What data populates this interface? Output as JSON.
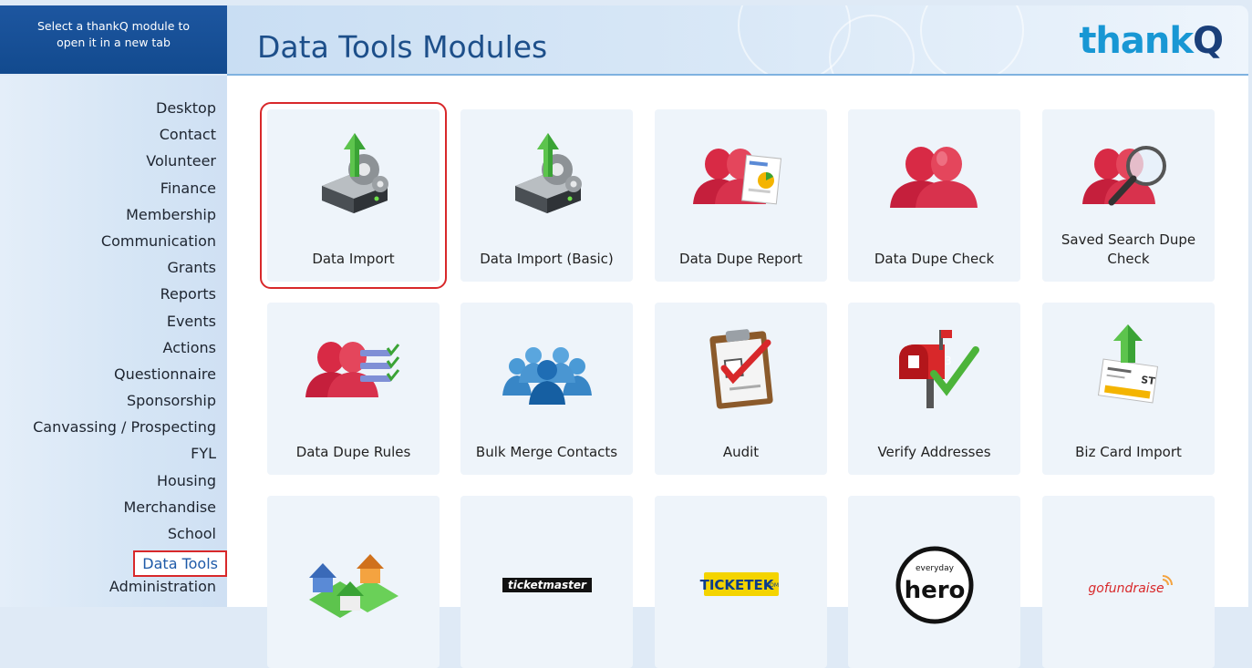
{
  "header": {
    "hint": "Select a thankQ module to open it in a new tab",
    "title": "Data Tools Modules",
    "logo_main": "thank",
    "logo_accent": "Q"
  },
  "sidebar": {
    "items": [
      {
        "label": "Desktop"
      },
      {
        "label": "Contact"
      },
      {
        "label": "Volunteer"
      },
      {
        "label": "Finance"
      },
      {
        "label": "Membership"
      },
      {
        "label": "Communication"
      },
      {
        "label": "Grants"
      },
      {
        "label": "Reports"
      },
      {
        "label": "Events"
      },
      {
        "label": "Actions"
      },
      {
        "label": "Questionnaire"
      },
      {
        "label": "Sponsorship"
      },
      {
        "label": "Canvassing / Prospecting"
      },
      {
        "label": "FYL"
      },
      {
        "label": "Housing"
      },
      {
        "label": "Merchandise"
      },
      {
        "label": "School"
      },
      {
        "label": "Data Tools"
      },
      {
        "label": "Administration"
      }
    ],
    "active": "Data Tools"
  },
  "tiles": [
    {
      "label": "Data Import",
      "icon": "server-upload-icon"
    },
    {
      "label": "Data Import (Basic)",
      "icon": "server-upload-icon"
    },
    {
      "label": "Data Dupe Report",
      "icon": "people-report-icon"
    },
    {
      "label": "Data Dupe Check",
      "icon": "people-icon"
    },
    {
      "label": "Saved Search Dupe Check",
      "icon": "people-search-icon"
    },
    {
      "label": "Data Dupe Rules",
      "icon": "people-rules-icon"
    },
    {
      "label": "Bulk Merge Contacts",
      "icon": "group-merge-icon"
    },
    {
      "label": "Audit",
      "icon": "clipboard-check-icon"
    },
    {
      "label": "Verify Addresses",
      "icon": "mailbox-check-icon"
    },
    {
      "label": "Biz Card Import",
      "icon": "bizcard-upload-icon"
    },
    {
      "label": "",
      "icon": "houses-icon"
    },
    {
      "label": "",
      "icon": "ticketmaster-logo",
      "logo_text": "ticketmaster"
    },
    {
      "label": "",
      "icon": "ticketek-logo",
      "logo_text": "TICKETEK",
      "logo_sub": ".COM"
    },
    {
      "label": "",
      "icon": "everyday-hero-logo",
      "logo_text": "hero",
      "logo_sub": "everyday"
    },
    {
      "label": "",
      "icon": "gofundraise-logo",
      "logo_text": "gofundraise"
    }
  ],
  "colors": {
    "header_blue": "#124a8e",
    "title_blue": "#1d4f8a",
    "logo_blue": "#1897d4",
    "highlight_red": "#d8282a",
    "tile_bg": "#eef4fa"
  }
}
